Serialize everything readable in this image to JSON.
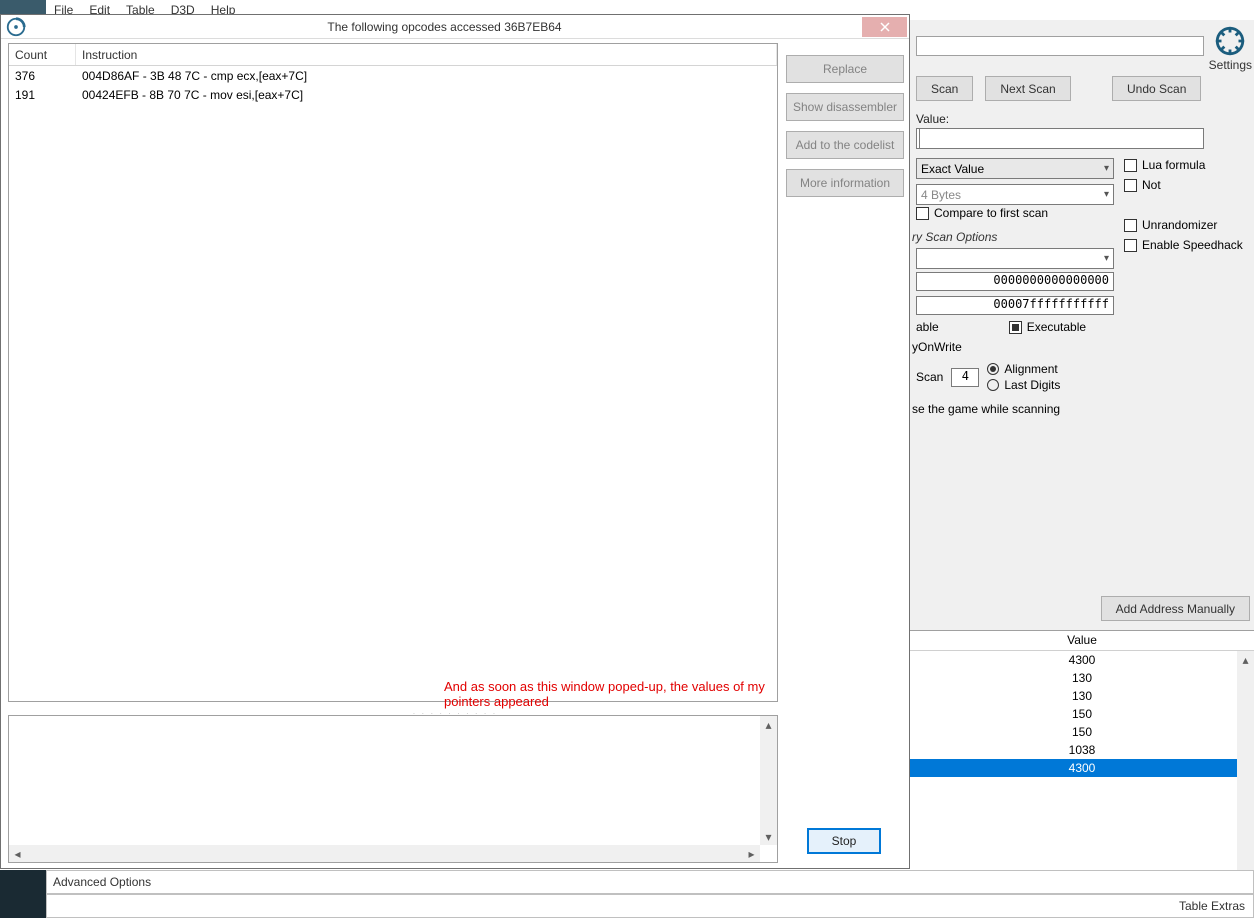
{
  "menus": {
    "file": "File",
    "edit": "Edit",
    "table": "Table",
    "d3d": "D3D",
    "help": "Help"
  },
  "dialog": {
    "title": "The following opcodes accessed 36B7EB64",
    "columns": {
      "count": "Count",
      "instruction": "Instruction"
    },
    "rows": [
      {
        "count": "376",
        "instruction": "004D86AF - 3B 48 7C  - cmp ecx,[eax+7C]"
      },
      {
        "count": "191",
        "instruction": "00424EFB - 8B 70 7C  - mov esi,[eax+7C]"
      }
    ],
    "annotation": "And as soon as this window poped-up, the values of my pointers appeared",
    "buttons": {
      "replace": "Replace",
      "disasm": "Show disassembler",
      "addcode": "Add to the codelist",
      "moreinfo": "More information",
      "stop": "Stop"
    }
  },
  "ce": {
    "settings": "Settings",
    "scanBtn": "Scan",
    "nextScan": "Next Scan",
    "undoScan": "Undo Scan",
    "valueLabel": "Value:",
    "scanType": "Exact Value",
    "valueType": "4 Bytes",
    "luaFormula": "Lua formula",
    "not": "Not",
    "compareFirst": "Compare to first scan",
    "scanOptions": "ry Scan Options",
    "addrStart": "0000000000000000",
    "addrStop": "00007fffffffffff",
    "able": "able",
    "executable": "Executable",
    "onwrite": "yOnWrite",
    "fastScan": "Scan",
    "fastVal": "4",
    "alignment": "Alignment",
    "lastdigits": "Last Digits",
    "pause": "se the game while scanning",
    "unrandom": "Unrandomizer",
    "speedhack": "Enable Speedhack",
    "addManual": "Add Address Manually",
    "valueHeader": "Value",
    "results": [
      "4300",
      "130",
      "130",
      "150",
      "150",
      "1038",
      "4300"
    ],
    "selectedIndex": 6
  },
  "bottom": {
    "advanced": "Advanced Options",
    "extras": "Table Extras"
  }
}
